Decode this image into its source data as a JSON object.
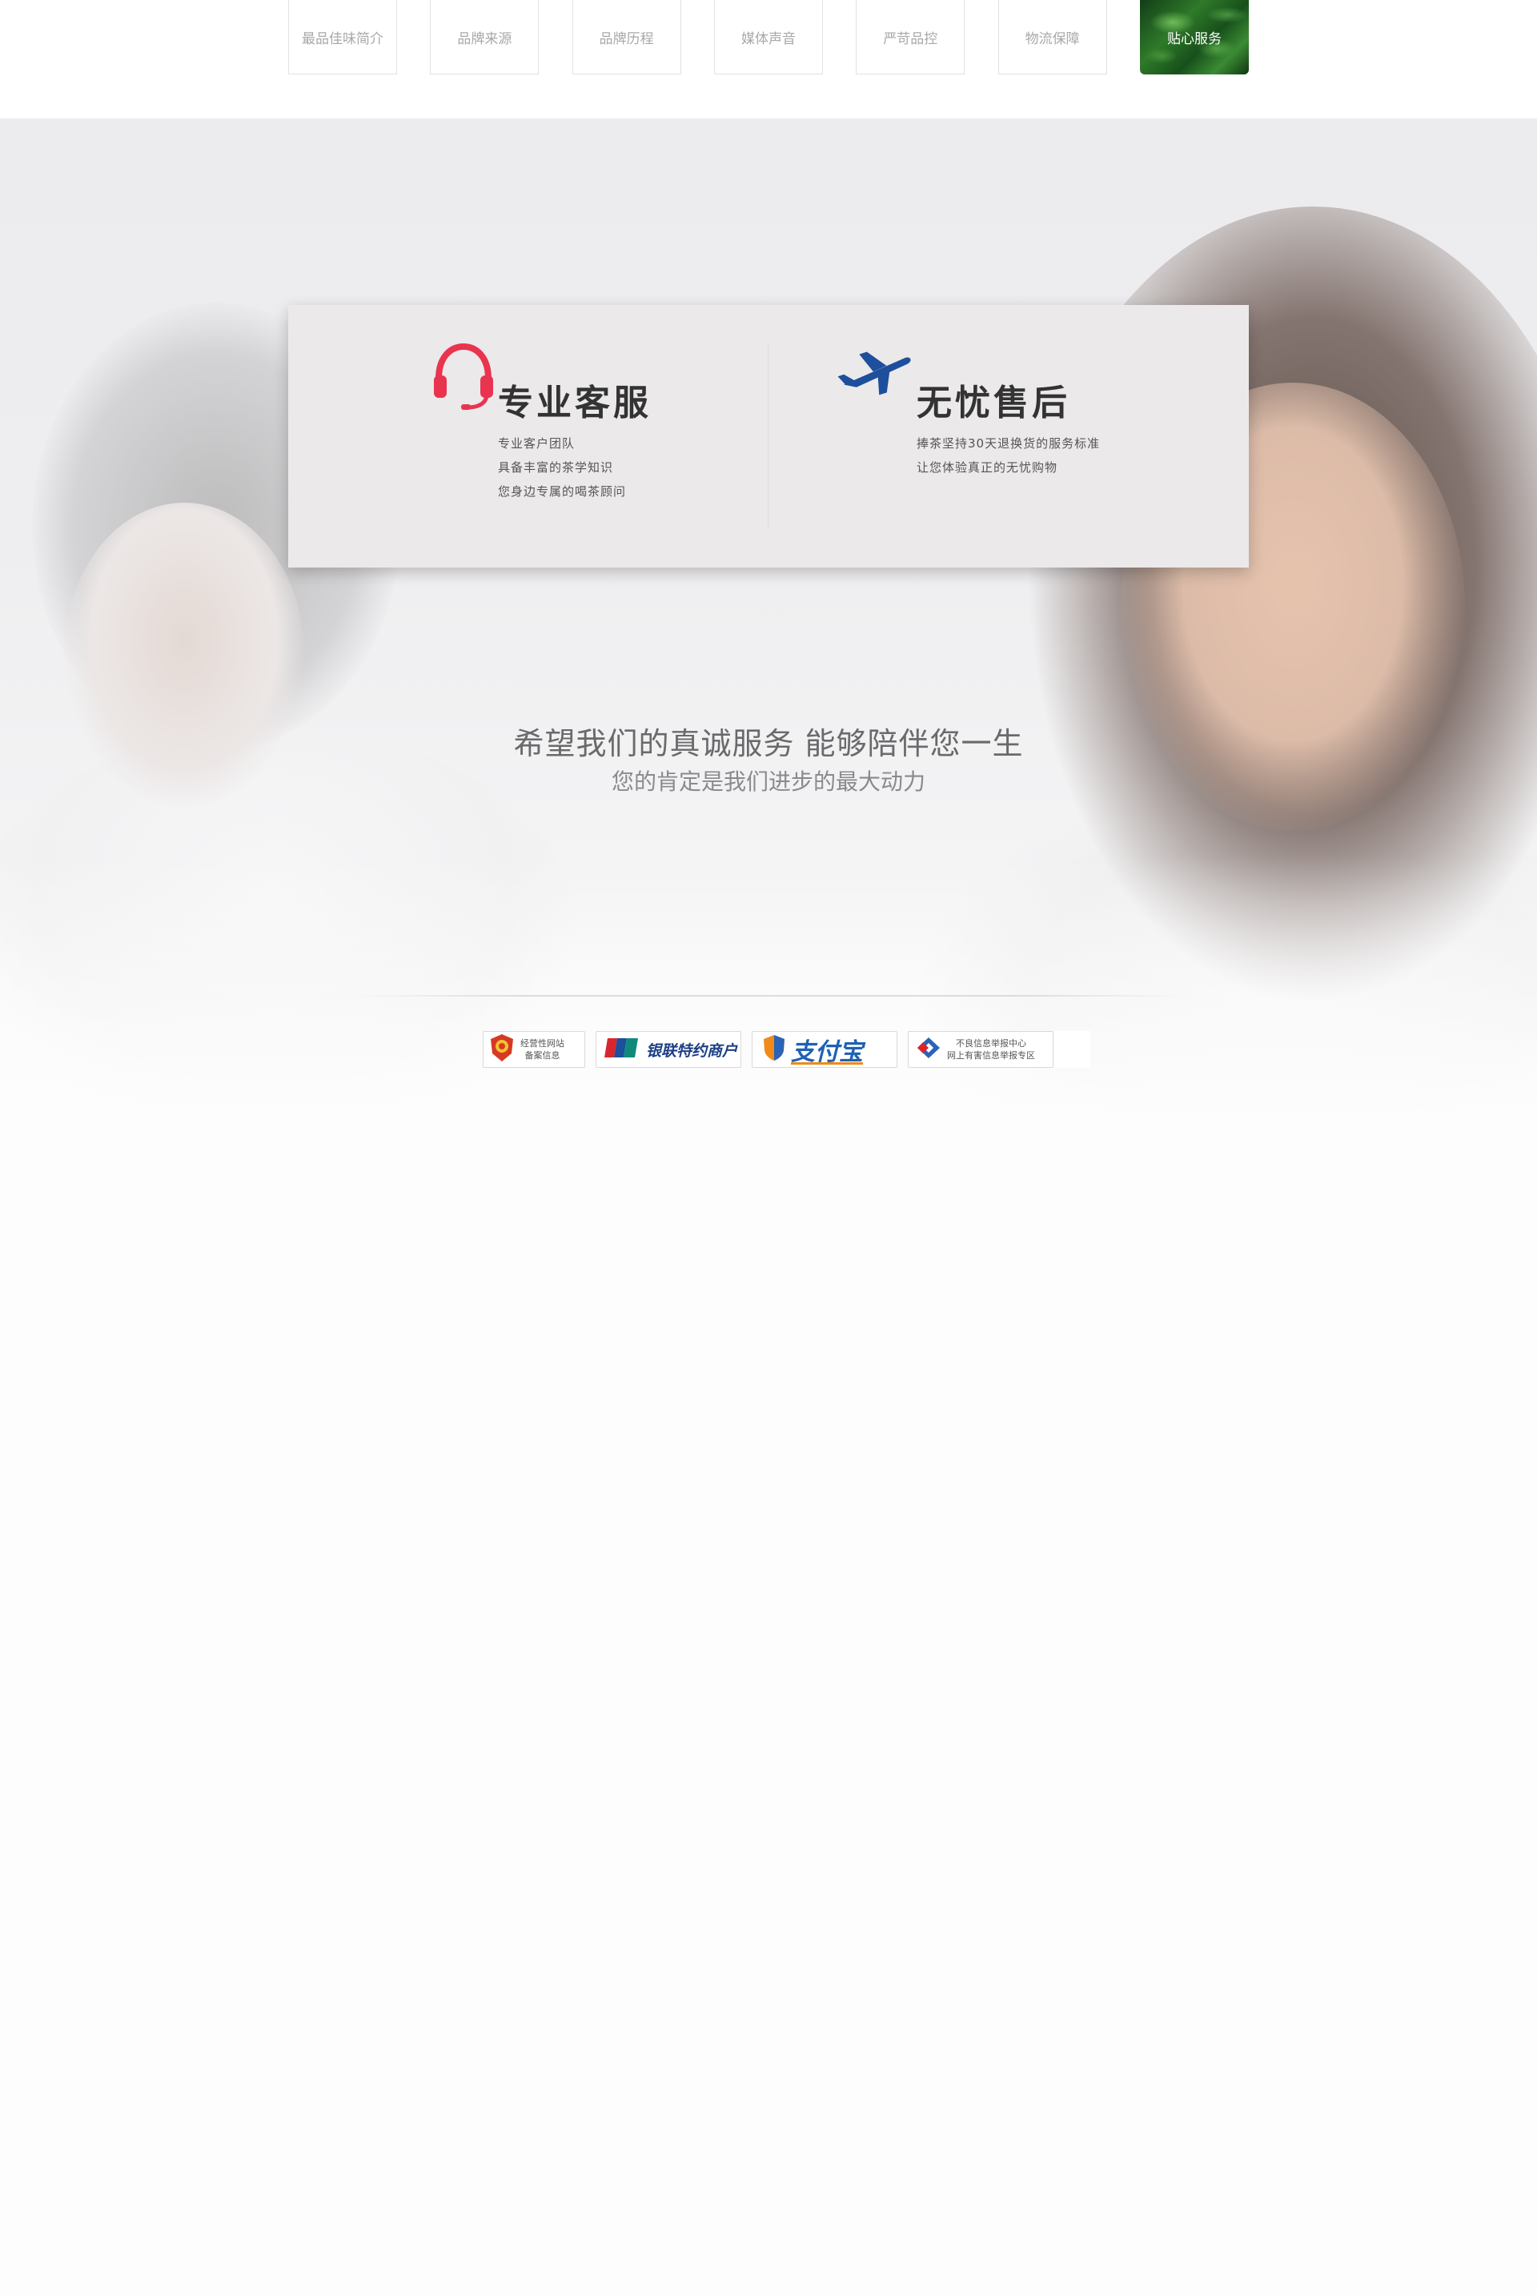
{
  "nav": {
    "tabs": [
      {
        "label": "最品佳味简介"
      },
      {
        "label": "品牌来源"
      },
      {
        "label": "品牌历程"
      },
      {
        "label": "媒体声音"
      },
      {
        "label": "严苛品控"
      },
      {
        "label": "物流保障"
      },
      {
        "label": "贴心服务",
        "active": true
      }
    ]
  },
  "features": {
    "service": {
      "icon": "headset-icon",
      "title": "专业客服",
      "lines": [
        "专业客户团队",
        "具备丰富的茶学知识",
        "您身边专属的喝茶顾问"
      ]
    },
    "aftersales": {
      "icon": "airplane-icon",
      "title": "无忧售后",
      "lines": [
        "捧茶坚持30天退换货的服务标准",
        "让您体验真正的无忧购物"
      ]
    }
  },
  "slogan": {
    "main": "希望我们的真诚服务  能够陪伴您一生",
    "sub": "您的肯定是我们进步的最大动力"
  },
  "badges": {
    "police": {
      "icon": "police-emblem-icon",
      "line1": "经营性网站",
      "line2": "备案信息"
    },
    "unionpay": {
      "icon": "unionpay-logo-icon",
      "label": "银联特约商户"
    },
    "alipay": {
      "icon": "alipay-shield-icon",
      "label": "支付宝"
    },
    "report": {
      "icon": "report-center-icon",
      "line1": "不良信息举报中心",
      "line2": "网上有害信息举报专区"
    }
  },
  "colors": {
    "headset": "#e8344f",
    "airplane": "#1d4f9c",
    "active_tab": "#2f7a2a"
  }
}
